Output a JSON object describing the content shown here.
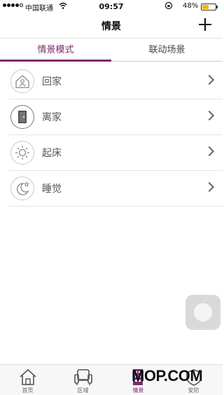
{
  "status_bar": {
    "carrier": "中国联通",
    "time": "09:57",
    "battery_pct": "48%",
    "battery_level": 0.48,
    "signal_bars": 4
  },
  "nav": {
    "title": "情景",
    "add_icon": "plus-icon"
  },
  "tabs": [
    {
      "label": "情景模式",
      "active": true
    },
    {
      "label": "联动场景",
      "active": false
    }
  ],
  "scenes": [
    {
      "label": "回家",
      "icon": "house-person-icon"
    },
    {
      "label": "离家",
      "icon": "door-icon"
    },
    {
      "label": "起床",
      "icon": "sun-icon"
    },
    {
      "label": "睡觉",
      "icon": "moon-star-icon"
    }
  ],
  "bottom_tabs": [
    {
      "label": "首页",
      "icon": "home-icon",
      "active": false
    },
    {
      "label": "区域",
      "icon": "armchair-icon",
      "active": false
    },
    {
      "label": "情景",
      "icon": "scene-building-icon",
      "active": true
    },
    {
      "label": "安防",
      "icon": "security-icon",
      "active": false
    }
  ],
  "watermark": "MOP.COM",
  "colors": {
    "accent": "#7b2a6f",
    "divider": "#e5e5e5"
  }
}
